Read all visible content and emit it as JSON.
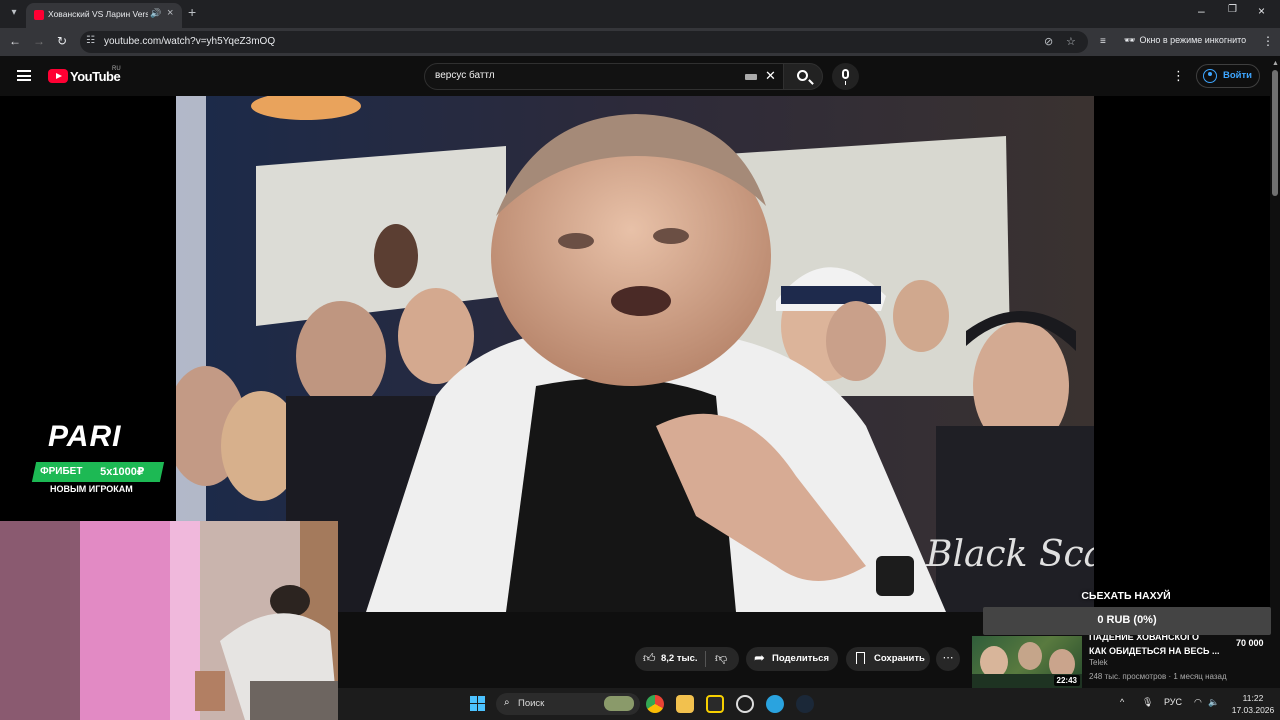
{
  "browser": {
    "tab_title": "Хованский VS Ларин Versus",
    "url": "youtube.com/watch?v=yh5YqeZ3mOQ",
    "incognito_label": "Окно в режиме инкогнито"
  },
  "youtube": {
    "logo_text": "YouTube",
    "region": "RU",
    "search_query": "версус баттл",
    "signin_label": "Войти"
  },
  "ad": {
    "brand": "PARI",
    "freebet": "ФРИБЕТ",
    "bonus": "5x1000₽",
    "audience": "НОВЫМ ИГРОКАМ"
  },
  "video": {
    "banner_text": "Black Scale"
  },
  "actions": {
    "likes": "8,2 тыс.",
    "share_label": "Поделиться",
    "save_label": "Сохранить"
  },
  "donation": {
    "title": "СЬЕХАТЬ НАХУЙ",
    "amount": "0 RUB (0%)"
  },
  "recommendation": {
    "title_line1": "ПАДЕНИЕ ХОВАНСКОГО",
    "title_line2": "КАК ОБИДЕТЬСЯ НА ВЕСЬ ...",
    "duration": "22:43",
    "channel": "Telek",
    "meta": "248 тыс. просмотров · 1 месяц назад",
    "overlay_count": "70 000"
  },
  "taskbar": {
    "search_label": "Поиск",
    "language": "РУС",
    "time": "11:22",
    "date": "17.03.2026"
  }
}
